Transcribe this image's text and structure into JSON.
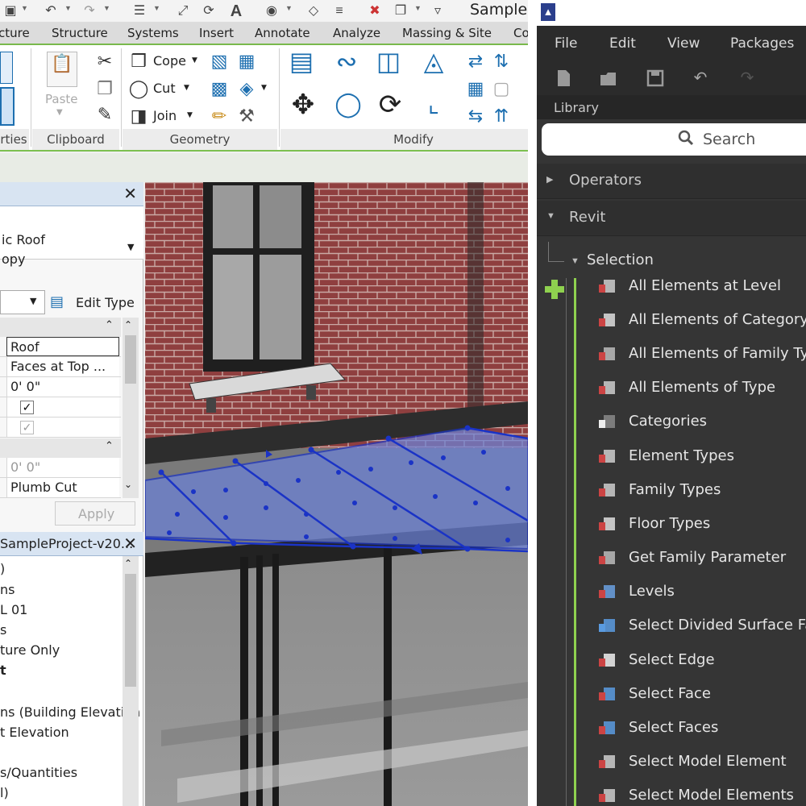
{
  "revit": {
    "doc_title": "Sample",
    "tabs": [
      "cture",
      "Structure",
      "Systems",
      "Insert",
      "Annotate",
      "Analyze",
      "Massing & Site",
      "Co"
    ],
    "ribbon": {
      "paste": "Paste",
      "cope": "Cope",
      "cut": "Cut",
      "join": "Join",
      "panels": [
        "rties",
        "Clipboard",
        "Geometry",
        "Modify"
      ]
    },
    "properties": {
      "type_line1": "ic Roof",
      "type_line2": "opy",
      "edit_type": "Edit Type",
      "rows": [
        "Roof",
        "Faces at Top ...",
        "0'  0\"",
        "",
        "",
        "",
        "0'  0\"",
        "Plumb Cut"
      ],
      "apply": "Apply"
    },
    "browser": {
      "title": "SampleProject-v20...",
      "items": [
        ")",
        "ns",
        "L 01",
        "s",
        "ture Only",
        "t",
        "",
        "ns (Building Elevation",
        "t Elevation",
        "",
        "s/Quantities",
        "l)"
      ]
    }
  },
  "dynamo": {
    "menus": [
      "File",
      "Edit",
      "View",
      "Packages"
    ],
    "library_label": "Library",
    "search_placeholder": "Search",
    "categories": [
      "Operators",
      "Revit"
    ],
    "subcategory": "Selection",
    "nodes": [
      "All Elements at Level",
      "All Elements of Category",
      "All Elements of Family Typ",
      "All Elements of Type",
      "Categories",
      "Element Types",
      "Family Types",
      "Floor Types",
      "Get Family Parameter",
      "Levels",
      "Select Divided Surface Far",
      "Select Edge",
      "Select Face",
      "Select Faces",
      "Select Model Element",
      "Select Model Elements"
    ]
  }
}
